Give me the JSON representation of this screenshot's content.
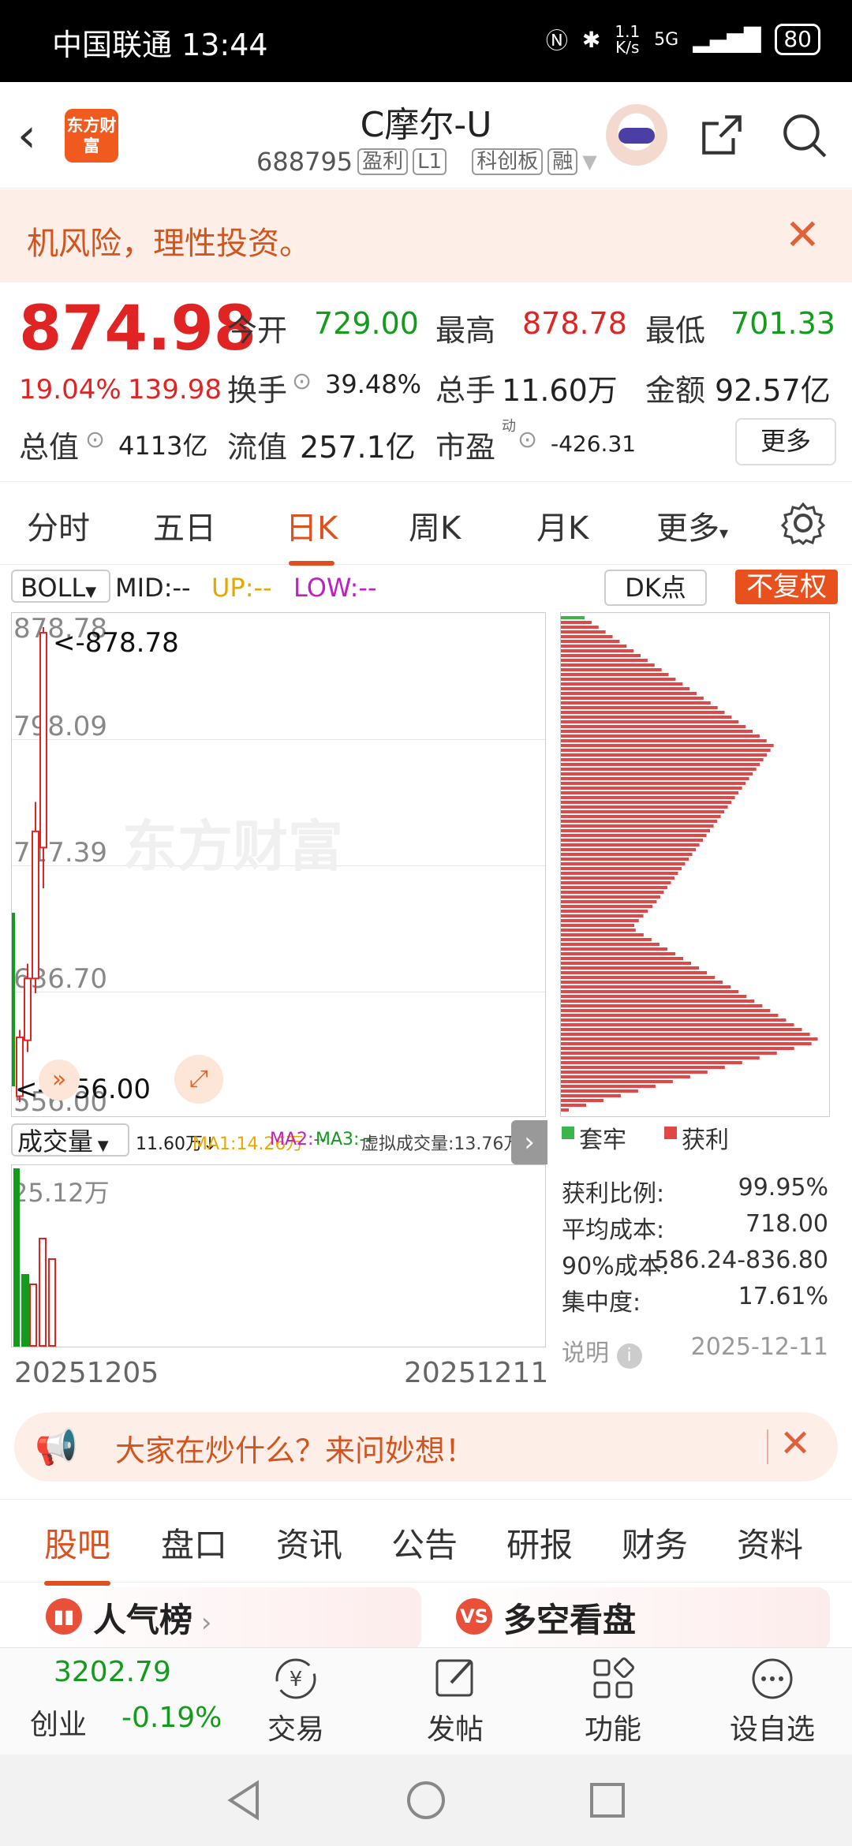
{
  "status": {
    "carrier_time": "中国联通 13:44",
    "speed_top": "1.1",
    "speed_unit": "K/s",
    "net": "5G",
    "battery": "80"
  },
  "header": {
    "title": "C摩尔-U",
    "code": "688795",
    "tag1": "盈利",
    "tag2": "L1",
    "tag3": "科创板",
    "tag4": "融",
    "logo_text": "东方财富"
  },
  "banner": {
    "text": "机风险，理性投资。"
  },
  "quote": {
    "price": "874.98",
    "change_pct": "19.04%",
    "change": "139.98",
    "open_label": "今开",
    "open": "729.00",
    "high_label": "最高",
    "high": "878.78",
    "low_label": "最低",
    "low": "701.33",
    "turnover_label": "换手",
    "turnover": "39.48%",
    "volume_label": "总手",
    "volume": "11.60万",
    "amount_label": "金额",
    "amount": "92.57亿",
    "mktcap_label": "总值",
    "mktcap": "4113亿",
    "float_label": "流值",
    "float": "257.1亿",
    "pe_label": "市盈",
    "pe_sup": "动",
    "pe": "-426.31",
    "more": "更多"
  },
  "ktabs": [
    "分时",
    "五日",
    "日K",
    "周K",
    "月K",
    "更多"
  ],
  "boll": {
    "name": "BOLL",
    "mid": "MID:--",
    "up": "UP:--",
    "low": "LOW:--",
    "dk": "DK点",
    "fq": "不复权"
  },
  "kchart": {
    "y_labels": [
      "878.78",
      "798.09",
      "717.39",
      "636.70",
      "556.00"
    ],
    "max_note": "<-878.78",
    "min_note": "<--556.00",
    "watermark": "东方财富"
  },
  "chart_data": {
    "type": "candlestick",
    "ylim": [
      556.0,
      878.78
    ],
    "candles": [
      {
        "open": 560,
        "close": 600,
        "high": 605,
        "low": 556
      },
      {
        "open": 598,
        "close": 640,
        "high": 650,
        "low": 590
      },
      {
        "open": 640,
        "close": 740,
        "high": 760,
        "low": 630
      },
      {
        "open": 729.0,
        "close": 874.98,
        "high": 878.78,
        "low": 701.33
      }
    ]
  },
  "vol": {
    "name": "成交量",
    "v": "11.60万↓",
    "ma1": "MA1:14.26万",
    "ma2": "MA2:--",
    "ma3": "MA3:--",
    "virt": "虚拟成交量:13.76万",
    "ymax": "25.12万"
  },
  "dates": {
    "start": "20251205",
    "end": "20251211"
  },
  "chip": {
    "legend_trap": "套牢",
    "legend_profit": "获利",
    "profit_ratio_label": "获利比例:",
    "profit_ratio": "99.95%",
    "avg_cost_label": "平均成本:",
    "avg_cost": "718.00",
    "cost90_label": "90%成本:",
    "cost90": "586.24-836.80",
    "conc_label": "集中度:",
    "conc": "17.61%",
    "note": "说明",
    "date": "2025-12-11"
  },
  "ask": {
    "text": "大家在炒什么？来问妙想！"
  },
  "btabs": [
    "股吧",
    "盘口",
    "资讯",
    "公告",
    "研报",
    "财务",
    "资料"
  ],
  "cards": {
    "left": "人气榜",
    "right": "多空看盘",
    "right_icon": "VS"
  },
  "bnav": {
    "index_value": "3202.79",
    "index_name": "创业",
    "index_change": "-0.19%",
    "trade": "交易",
    "post": "发帖",
    "func": "功能",
    "watch": "设自选"
  }
}
